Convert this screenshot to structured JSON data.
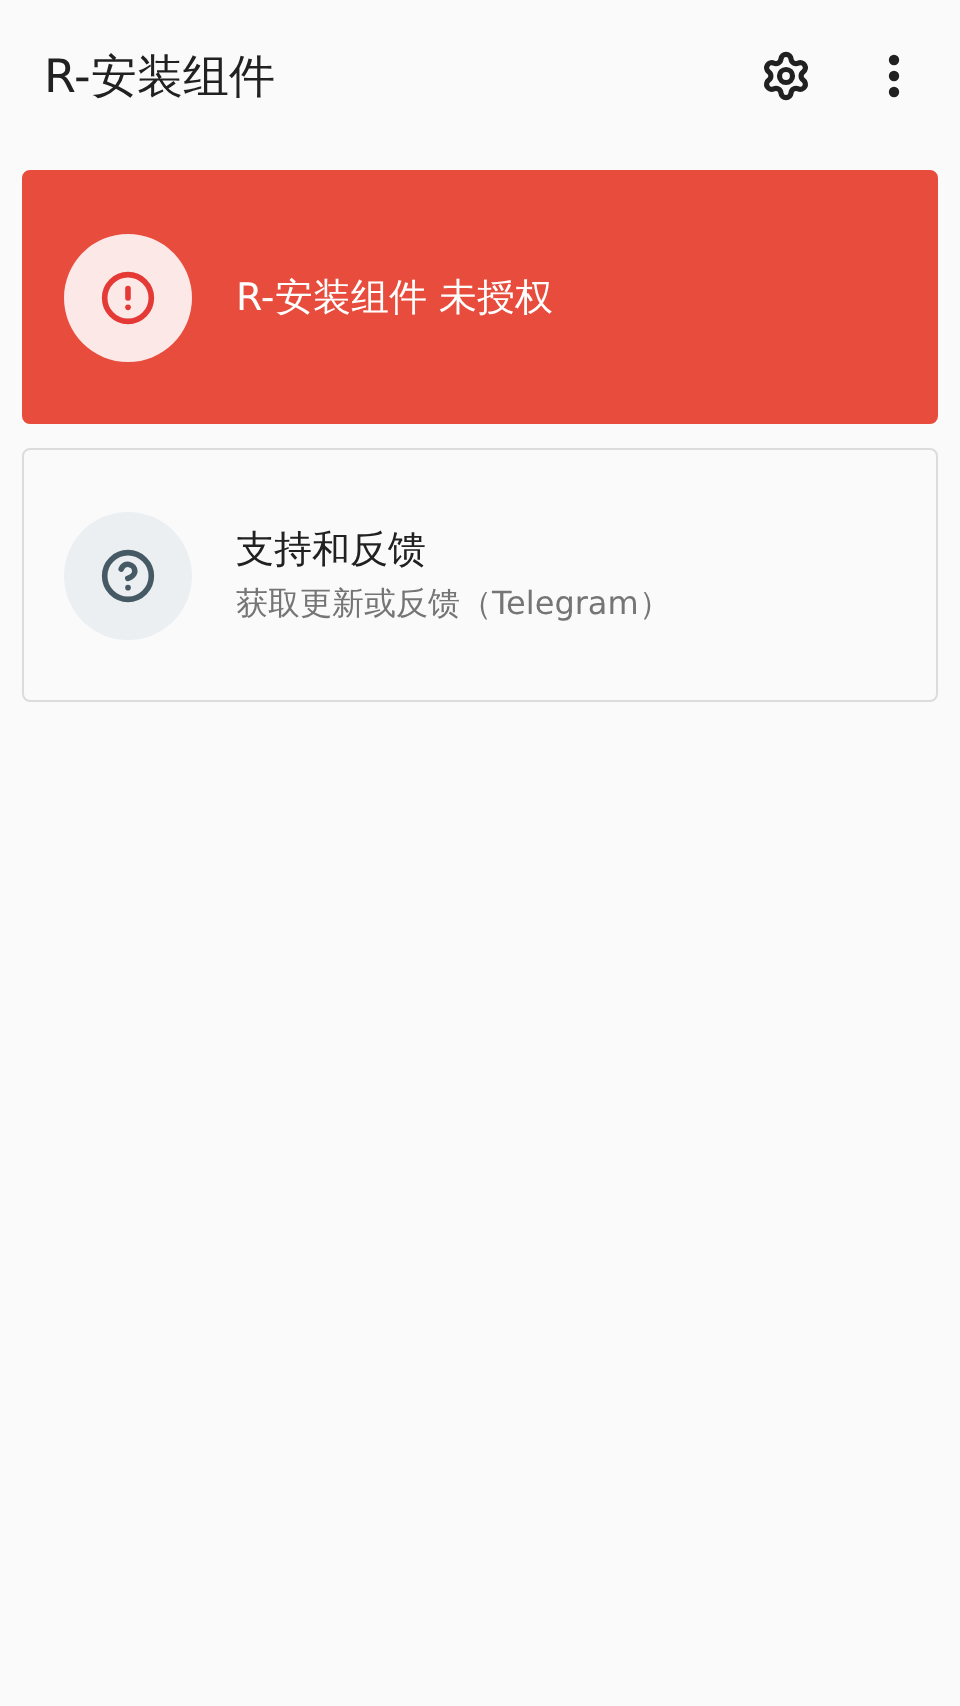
{
  "app_bar": {
    "title": "R-安装组件"
  },
  "cards": [
    {
      "kind": "error",
      "title": "R-安装组件 未授权"
    },
    {
      "kind": "info",
      "title": "支持和反馈",
      "subtitle": "获取更新或反馈（Telegram）"
    }
  ]
}
